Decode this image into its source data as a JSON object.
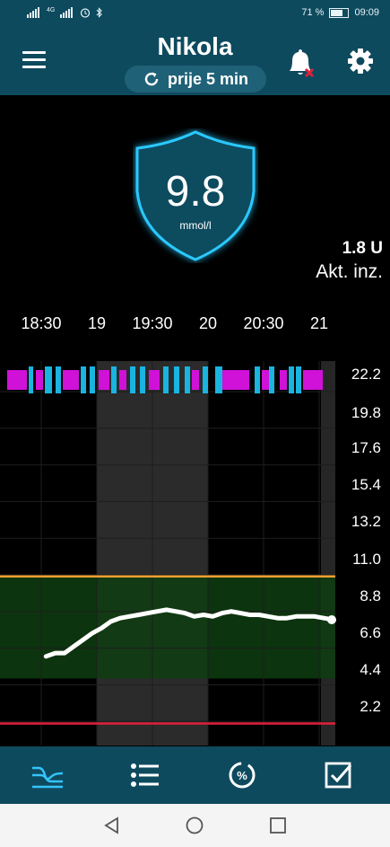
{
  "status_bar": {
    "signal_left": "4G",
    "battery": "71 %",
    "battery_fill": 0.71,
    "time": "09:09"
  },
  "header": {
    "title": "Nikola",
    "last_update": "prije 5 min"
  },
  "glucose": {
    "value": "9.8",
    "unit": "mmol/l"
  },
  "insulin": {
    "value": "1.8 U",
    "label": "Akt. inz."
  },
  "chart_data": {
    "type": "line",
    "x_tick_labels": [
      "18:30",
      "19",
      "19:30",
      "20",
      "20:30",
      "21"
    ],
    "y_tick_labels": [
      "22.2",
      "19.8",
      "17.6",
      "15.4",
      "13.2",
      "11.0",
      "8.8",
      "6.6",
      "4.4",
      "2.2"
    ],
    "ylim": [
      0,
      22.2
    ],
    "x_range": [
      "18:19",
      "21:00"
    ],
    "high_threshold": 11.0,
    "low_threshold": 3.9,
    "series": [
      {
        "x": [
          "18:20",
          "18:25",
          "18:30",
          "18:35",
          "18:40",
          "18:45",
          "18:50",
          "18:55",
          "19:00",
          "19:05",
          "19:10",
          "19:15",
          "19:20",
          "19:25",
          "19:30",
          "19:35",
          "19:40",
          "19:45",
          "19:50",
          "19:55",
          "20:00",
          "20:05",
          "20:10",
          "20:15",
          "20:20",
          "20:25",
          "20:30",
          "20:35",
          "20:40",
          "20:45",
          "20:50",
          "20:55"
        ],
        "values": [
          7.6,
          7.8,
          7.8,
          8.2,
          8.6,
          9.0,
          9.3,
          9.7,
          9.9,
          10.0,
          10.1,
          10.2,
          10.3,
          10.4,
          10.3,
          10.2,
          10.0,
          10.1,
          10.0,
          10.2,
          10.3,
          10.2,
          10.1,
          10.1,
          10.0,
          9.9,
          9.9,
          10.0,
          10.0,
          10.0,
          9.9,
          9.8
        ]
      }
    ],
    "colors": {
      "line": "#ffffff",
      "high": "#f0a030",
      "low": "#e0203a",
      "target_fill": "#0e3d10",
      "night_band": "#2b2b2b"
    }
  },
  "nav": {
    "items": [
      "graph-icon",
      "list-icon",
      "percent-icon",
      "checklist-icon"
    ]
  }
}
